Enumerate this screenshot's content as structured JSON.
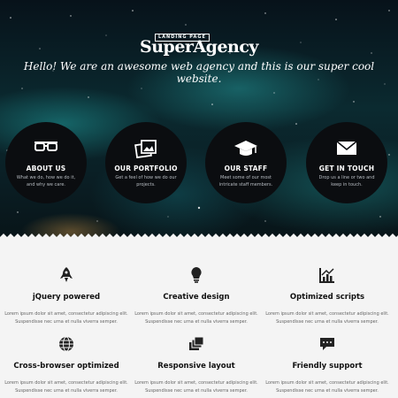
{
  "logo": {
    "tag": "LANDING PAGE",
    "name": "SuperAgency"
  },
  "hero": {
    "tagline": "Hello! We are an awesome web agency and this is our super cool website."
  },
  "circles": [
    {
      "icon": "glasses-icon",
      "title": "ABOUT US",
      "desc": "What we do, how we do it, and why we care."
    },
    {
      "icon": "images-icon",
      "title": "OUR PORTFOLIO",
      "desc": "Get a feel of how we do our projects."
    },
    {
      "icon": "graduation-cap-icon",
      "title": "OUR STAFF",
      "desc": "Meet some of our most intricate staff members."
    },
    {
      "icon": "envelope-icon",
      "title": "GET IN TOUCH",
      "desc": "Drop us a line or two and keep in touch."
    }
  ],
  "features": [
    {
      "icon": "rocket-icon",
      "title": "jQuery powered",
      "text_line1": "Lorem ipsum dolor sit amet, consectetur adipiscing elit.",
      "text_line2": "Suspendisse nec urna et nulla viverra semper."
    },
    {
      "icon": "lightbulb-icon",
      "title": "Creative design",
      "text_line1": "Lorem ipsum dolor sit amet, consectetur adipiscing elit.",
      "text_line2": "Suspendisse nec urna et nulla viverra semper."
    },
    {
      "icon": "chart-icon",
      "title": "Optimized scripts",
      "text_line1": "Lorem ipsum dolor sit amet, consectetur adipiscing elit.",
      "text_line2": "Suspendisse nec urna et nulla viverra semper."
    },
    {
      "icon": "globe-icon",
      "title": "Cross-browser optimized",
      "text_line1": "Lorem ipsum dolor sit amet, consectetur adipiscing elit.",
      "text_line2": "Suspendisse nec urna et nulla viverra semper."
    },
    {
      "icon": "layers-icon",
      "title": "Responsive layout",
      "text_line1": "Lorem ipsum dolor sit amet, consectetur adipiscing elit.",
      "text_line2": "Suspendisse nec urna et nulla viverra semper."
    },
    {
      "icon": "speech-bubble-icon",
      "title": "Friendly support",
      "text_line1": "Lorem ipsum dolor sit amet, consectetur adipiscing elit.",
      "text_line2": "Suspendisse nec urna et nulla viverra semper."
    }
  ],
  "colors": {
    "hero_dark": "#07121a",
    "hero_teal": "#1e9696",
    "circle_bg": "#0b0d10",
    "section_bg": "#f4f4f4"
  }
}
